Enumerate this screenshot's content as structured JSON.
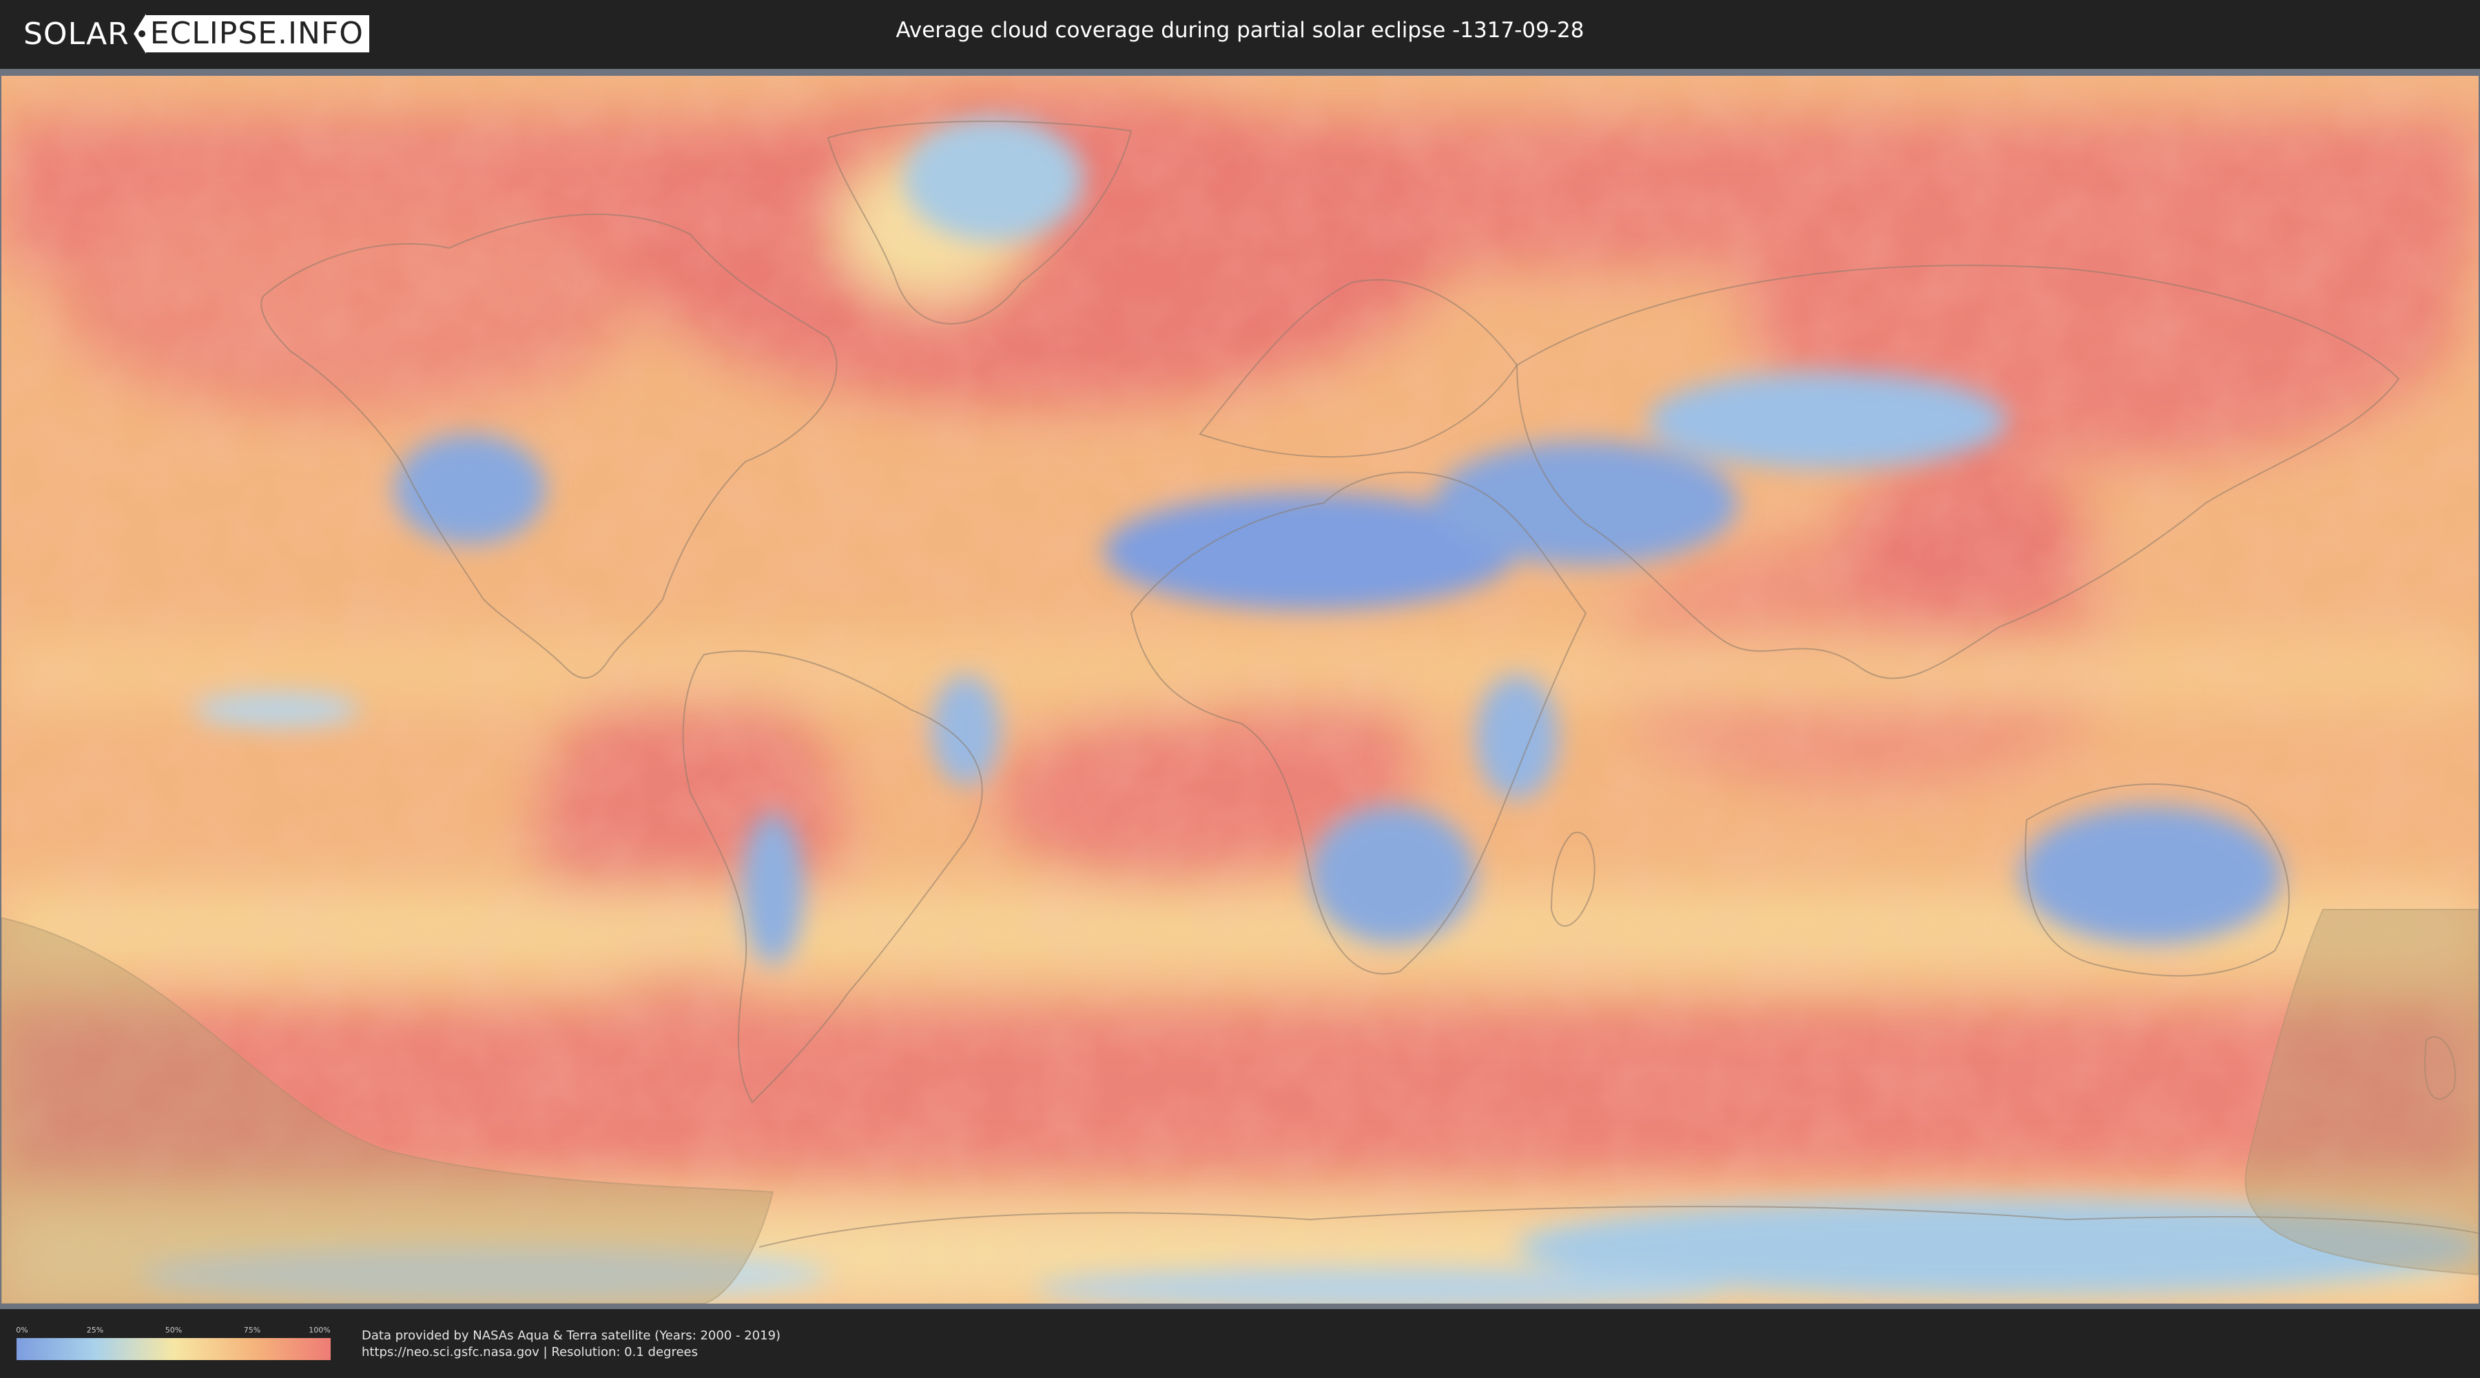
{
  "header": {
    "logo_part1": "SOLAR",
    "logo_part2": "ECLIPSE.INFO",
    "title": "Average cloud coverage during partial solar eclipse -1317-09-28"
  },
  "legend": {
    "ticks": [
      "0%",
      "25%",
      "50%",
      "75%",
      "100%"
    ],
    "tick_fractions": [
      0,
      0.25,
      0.5,
      0.75,
      1.0
    ],
    "colors": [
      "#7d9ddf",
      "#a9d1ea",
      "#f6e6a4",
      "#f5b57c",
      "#ee7c75"
    ]
  },
  "footer": {
    "credit_line1": "Data provided by NASAs Aqua & Terra satellite (Years: 2000 - 2019)",
    "credit_line2": "https://neo.sci.gsfc.nasa.gov | Resolution: 0.1 degrees"
  },
  "map": {
    "projection": "equirectangular",
    "colors": {
      "cloudy": "#ec8378",
      "mid": "#f4ab7c",
      "light": "#f6d08f",
      "clear": "#86a8e0",
      "very_clear": "#aacfe7",
      "eclipse_overlay": "#b49a6e"
    }
  }
}
